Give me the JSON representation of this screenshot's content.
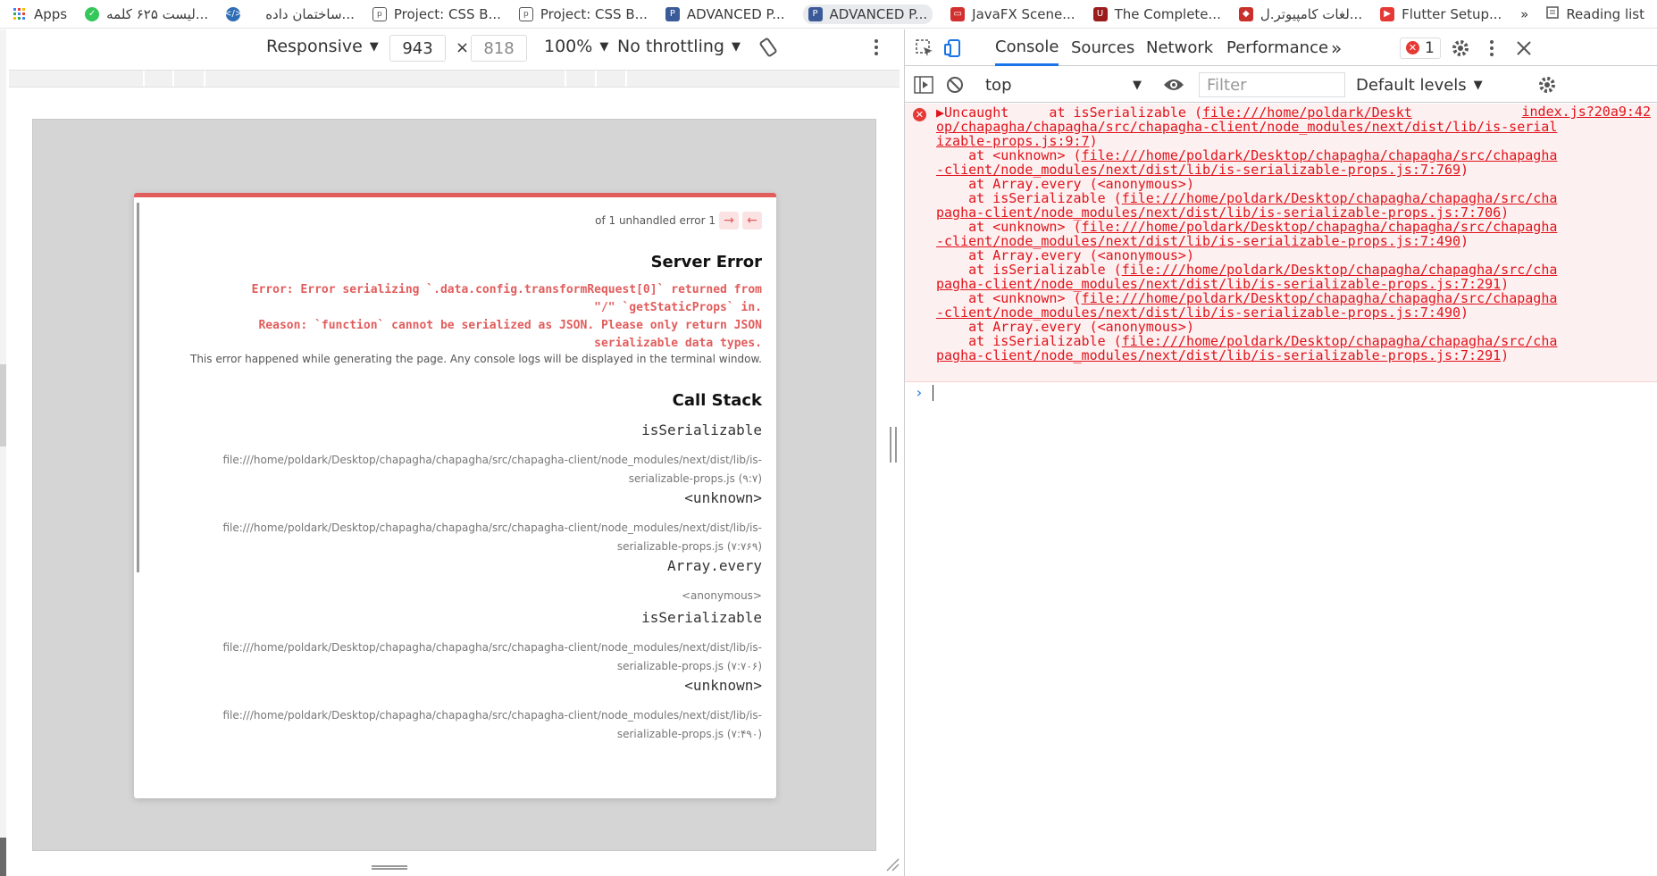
{
  "bookmarks": [
    {
      "label": "Apps",
      "color": "#4285f4"
    },
    {
      "label": "لیست ۶۲۵ کلمه...",
      "color": "#34c759"
    },
    {
      "label": "",
      "color": "#2d6db5"
    },
    {
      "label": "ساختمان داده...",
      "color": "#ffffff"
    },
    {
      "label": "Project: CSS B...",
      "color": "#555555"
    },
    {
      "label": "Project: CSS B...",
      "color": "#555555"
    },
    {
      "label": "ADVANCED P...",
      "color": "#3b5a9a"
    },
    {
      "label": "ADVANCED P...",
      "color": "#3b5a9a"
    },
    {
      "label": "JavaFX Scene...",
      "color": "#d32f2f"
    },
    {
      "label": "The Complete...",
      "color": "#9c1c1c"
    },
    {
      "label": "لغات کامپیوتر.ل...",
      "color": "#c9302c"
    },
    {
      "label": "Flutter Setup...",
      "color": "#e53935"
    }
  ],
  "more_bookmarks": "»",
  "reading_list": "Reading list",
  "device_toolbar": {
    "mode": "Responsive",
    "width": "943",
    "height": "818",
    "times": "×",
    "zoom": "100%",
    "throttling": "No throttling"
  },
  "error_card": {
    "counter": "of 1 unhandled error 1",
    "title": "Server Error",
    "message": [
      "Error: Error serializing `.data.config.transformRequest[0]` returned from",
      "\"/\" `getStaticProps` in.",
      "Reason: `function` cannot be serialized as JSON. Please only return JSON",
      "serializable data types."
    ],
    "note": "This error happened while generating the page. Any console logs will be displayed in the terminal window.",
    "call_stack_title": "Call Stack",
    "frames": [
      {
        "fn": "isSerializable",
        "loc1": "file:///home/poldark/Desktop/chapagha/chapagha/src/chapagha-client/node_modules/next/dist/lib/is-",
        "loc2": "serializable-props.js (۹:۷)"
      },
      {
        "fn": "<unknown>",
        "loc1": "file:///home/poldark/Desktop/chapagha/chapagha/src/chapagha-client/node_modules/next/dist/lib/is-",
        "loc2": "serializable-props.js (۷:۷۶۹)"
      },
      {
        "fn": "Array.every",
        "loc1": "<anonymous>",
        "loc2": ""
      },
      {
        "fn": "isSerializable",
        "loc1": "file:///home/poldark/Desktop/chapagha/chapagha/src/chapagha-client/node_modules/next/dist/lib/is-",
        "loc2": "serializable-props.js (۷:۷۰۶)"
      },
      {
        "fn": "<unknown>",
        "loc1": "file:///home/poldark/Desktop/chapagha/chapagha/src/chapagha-client/node_modules/next/dist/lib/is-",
        "loc2": "serializable-props.js (۷:۴۹۰)"
      }
    ]
  },
  "devtools": {
    "tabs": [
      "Console",
      "Sources",
      "Network",
      "Performance"
    ],
    "more_tabs": "»",
    "error_count": "1",
    "context": "top",
    "filter_placeholder": "Filter",
    "levels": "Default levels",
    "source_link": "index.js?20a9:42",
    "console_lines": [
      {
        "pre": "▶Uncaught     at isSerializable (",
        "link": "file:///home/poldark/Deskt",
        "post": ""
      },
      {
        "pre": "",
        "link": "op/chapagha/chapagha/src/chapagha-client/node_modules/next/dist/lib/is-serial",
        "post": ""
      },
      {
        "pre": "",
        "link": "izable-props.js:9:7",
        "post": ")"
      },
      {
        "pre": "    at <unknown> (",
        "link": "file:///home/poldark/Desktop/chapagha/chapagha/src/chapagha",
        "post": ""
      },
      {
        "pre": "",
        "link": "-client/node_modules/next/dist/lib/is-serializable-props.js:7:769",
        "post": ")"
      },
      {
        "pre": "    at Array.every (<anonymous>)",
        "link": "",
        "post": ""
      },
      {
        "pre": "    at isSerializable (",
        "link": "file:///home/poldark/Desktop/chapagha/chapagha/src/cha",
        "post": ""
      },
      {
        "pre": "",
        "link": "pagha-client/node_modules/next/dist/lib/is-serializable-props.js:7:706",
        "post": ")"
      },
      {
        "pre": "    at <unknown> (",
        "link": "file:///home/poldark/Desktop/chapagha/chapagha/src/chapagha",
        "post": ""
      },
      {
        "pre": "",
        "link": "-client/node_modules/next/dist/lib/is-serializable-props.js:7:490",
        "post": ")"
      },
      {
        "pre": "    at Array.every (<anonymous>)",
        "link": "",
        "post": ""
      },
      {
        "pre": "    at isSerializable (",
        "link": "file:///home/poldark/Desktop/chapagha/chapagha/src/cha",
        "post": ""
      },
      {
        "pre": "",
        "link": "pagha-client/node_modules/next/dist/lib/is-serializable-props.js:7:291",
        "post": ")"
      },
      {
        "pre": "    at <unknown> (",
        "link": "file:///home/poldark/Desktop/chapagha/chapagha/src/chapagha",
        "post": ""
      },
      {
        "pre": "",
        "link": "-client/node_modules/next/dist/lib/is-serializable-props.js:7:490",
        "post": ")"
      },
      {
        "pre": "    at Array.every (<anonymous>)",
        "link": "",
        "post": ""
      },
      {
        "pre": "    at isSerializable (",
        "link": "file:///home/poldark/Desktop/chapagha/chapagha/src/cha",
        "post": ""
      },
      {
        "pre": "",
        "link": "pagha-client/node_modules/next/dist/lib/is-serializable-props.js:7:291",
        "post": ")"
      }
    ]
  },
  "colors": {
    "error_red": "#e0131b",
    "accent": "#1a73e8",
    "card_border": "#e25c5c"
  }
}
